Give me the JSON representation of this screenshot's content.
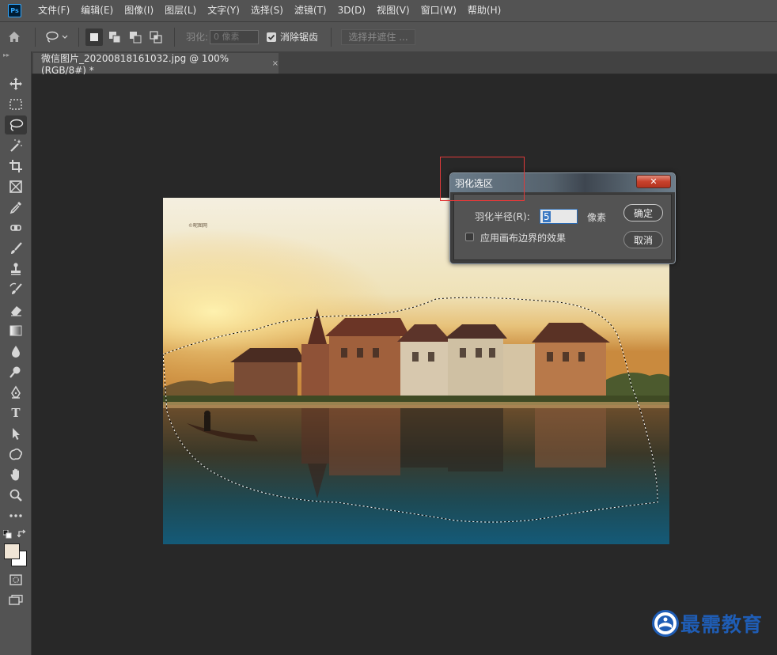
{
  "app": {
    "logo_text": "Ps"
  },
  "menu": {
    "items": [
      "文件(F)",
      "编辑(E)",
      "图像(I)",
      "图层(L)",
      "文字(Y)",
      "选择(S)",
      "滤镜(T)",
      "3D(D)",
      "视图(V)",
      "窗口(W)",
      "帮助(H)"
    ]
  },
  "options": {
    "feather_label": "羽化:",
    "feather_placeholder": "0 像素",
    "antialias_label": "消除锯齿",
    "antialias_checked": true,
    "select_mask_label": "选择并遮住 ..."
  },
  "document": {
    "tab_title": "微信图片_20200818161032.jpg @ 100%(RGB/8#) *",
    "close_glyph": "×",
    "image_watermark": "©昵图网"
  },
  "tools": [
    {
      "name": "move-tool",
      "icon": "move-icon"
    },
    {
      "name": "marquee-tool",
      "icon": "marquee-icon"
    },
    {
      "name": "lasso-tool",
      "icon": "lasso-icon",
      "active": true
    },
    {
      "name": "magic-wand-tool",
      "icon": "magic-wand-icon"
    },
    {
      "name": "crop-tool",
      "icon": "crop-icon"
    },
    {
      "name": "frame-tool",
      "icon": "frame-icon"
    },
    {
      "name": "eyedropper-tool",
      "icon": "eyedropper-icon"
    },
    {
      "name": "healing-brush-tool",
      "icon": "bandage-icon"
    },
    {
      "name": "brush-tool",
      "icon": "brush-icon"
    },
    {
      "name": "clone-stamp-tool",
      "icon": "stamp-icon"
    },
    {
      "name": "history-brush-tool",
      "icon": "history-brush-icon"
    },
    {
      "name": "eraser-tool",
      "icon": "eraser-icon"
    },
    {
      "name": "gradient-tool",
      "icon": "gradient-icon"
    },
    {
      "name": "blur-tool",
      "icon": "drop-icon"
    },
    {
      "name": "dodge-tool",
      "icon": "dodge-icon"
    },
    {
      "name": "pen-tool",
      "icon": "pen-icon"
    },
    {
      "name": "type-tool",
      "icon": "type-icon",
      "glyph": "T"
    },
    {
      "name": "path-selection-tool",
      "icon": "arrow-icon"
    },
    {
      "name": "shape-tool",
      "icon": "shape-icon"
    },
    {
      "name": "hand-tool",
      "icon": "hand-icon"
    },
    {
      "name": "zoom-tool",
      "icon": "zoom-icon"
    },
    {
      "name": "more-tools",
      "icon": "ellipsis-icon"
    }
  ],
  "swatches": {
    "foreground": "#f1e6d6",
    "background": "#ffffff"
  },
  "dialog": {
    "title": "羽化选区",
    "close_glyph": "✕",
    "radius_label": "羽化半径(R):",
    "radius_value": "5",
    "radius_unit": "像素",
    "apply_label": "应用画布边界的效果",
    "apply_checked": false,
    "ok_label": "确定",
    "cancel_label": "取消"
  },
  "brand": {
    "text": "最需教育",
    "color": "#1f5db5"
  },
  "colors": {
    "ui_panel": "#535353",
    "canvas_bg": "#282828",
    "highlight": "#e03a3a",
    "selection_accent": "#3a78c2"
  }
}
